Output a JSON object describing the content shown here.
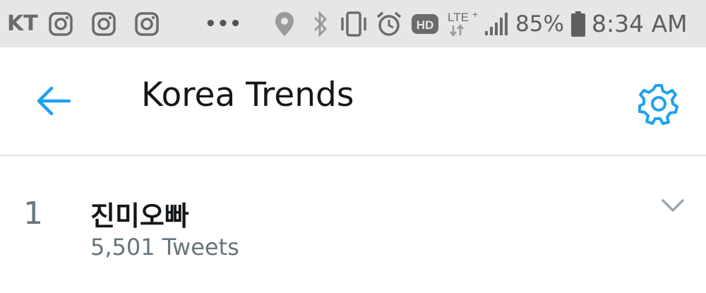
{
  "status_bar": {
    "carrier": "KT",
    "notification_icons": [
      "instagram-icon",
      "instagram-icon",
      "instagram-icon"
    ],
    "more_indicator": "•••",
    "system_icons": [
      "location-icon",
      "bluetooth-icon",
      "vibrate-icon",
      "alarm-icon",
      "hd-icon",
      "lte-plus-icon",
      "signal-icon"
    ],
    "battery_percent": "85%",
    "time": "8:34 AM"
  },
  "header": {
    "title": "Korea Trends",
    "back_icon": "arrow-left-icon",
    "settings_icon": "gear-icon",
    "accent_color": "#1da1f2"
  },
  "trends": [
    {
      "rank": "1",
      "name": "진미오빠",
      "tweet_count": "5,501 Tweets",
      "menu_icon": "chevron-down-icon"
    }
  ],
  "colors": {
    "status_bar_bg": "#e6e6e6",
    "primary_text": "#14171a",
    "secondary_text": "#66757f",
    "divider": "#dbe3e7"
  }
}
